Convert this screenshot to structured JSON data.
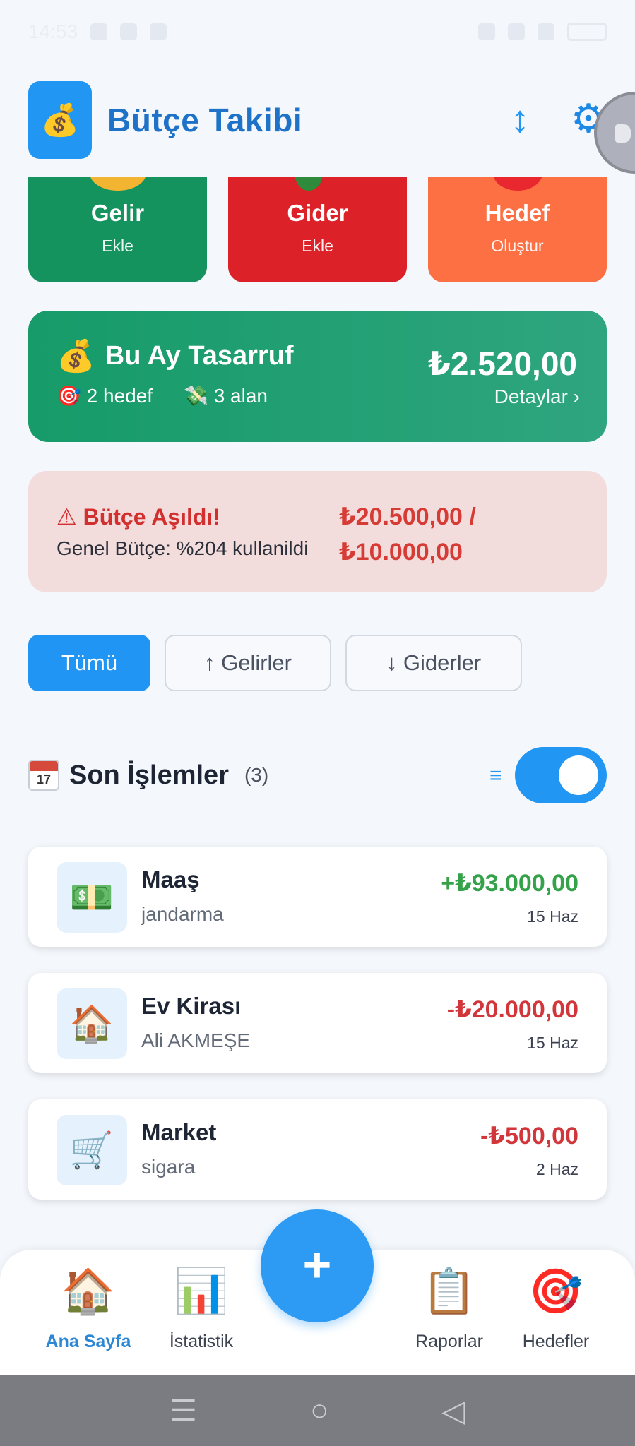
{
  "status_bar": {
    "time": "14:53"
  },
  "header": {
    "logo": "money-bag",
    "title": "Bütçe Takibi"
  },
  "quick_actions": [
    {
      "title": "Gelir",
      "sub": "Ekle",
      "color": "#15935f"
    },
    {
      "title": "Gider",
      "sub": "Ekle",
      "color": "#dc2228"
    },
    {
      "title": "Hedef",
      "sub": "Oluştur",
      "color": "#fd7043"
    }
  ],
  "savings": {
    "emoji": "💰",
    "title": "Bu Ay Tasarruf",
    "goals": "🎯 2 hedef",
    "areas": "💸 3 alan",
    "amount": "₺2.520,00",
    "details": "Detaylar ›"
  },
  "alert": {
    "title": "⚠ Bütçe Aşıldı!",
    "sub": "Genel Bütçe: %204 kullanildi",
    "amount_line1": "₺20.500,00 /",
    "amount_line2": "₺10.000,00"
  },
  "filters": [
    {
      "label": "Tümü",
      "active": true
    },
    {
      "label": "↑ Gelirler",
      "active": false
    },
    {
      "label": "↓ Giderler",
      "active": false
    }
  ],
  "recent": {
    "title": "Son İşlemler",
    "count": "(3)",
    "toggle_on": true
  },
  "transactions": [
    {
      "icon": "💵",
      "title": "Maaş",
      "sub": "jandarma",
      "amount": "+₺93.000,00",
      "date": "15 Haz",
      "type": "income"
    },
    {
      "icon": "🏠",
      "title": "Ev Kirası",
      "sub": "Ali AKMEŞE",
      "amount": "-₺20.000,00",
      "date": "15 Haz",
      "type": "expense"
    },
    {
      "icon": "🛒",
      "title": "Market",
      "sub": "sigara",
      "amount": "-₺500,00",
      "date": "2 Haz",
      "type": "expense"
    }
  ],
  "bottom_nav": [
    {
      "icon": "🏠",
      "label": "Ana Sayfa",
      "active": true
    },
    {
      "icon": "📊",
      "label": "İstatistik",
      "active": false
    },
    {
      "icon": "📋",
      "label": "Raporlar",
      "active": false
    },
    {
      "icon": "🎯",
      "label": "Hedefler",
      "active": false
    }
  ],
  "fab": {
    "label": "+"
  },
  "colors": {
    "primary": "#2196f3",
    "income": "#35a24a",
    "expense": "#d2363a",
    "savings": "#169b69"
  }
}
